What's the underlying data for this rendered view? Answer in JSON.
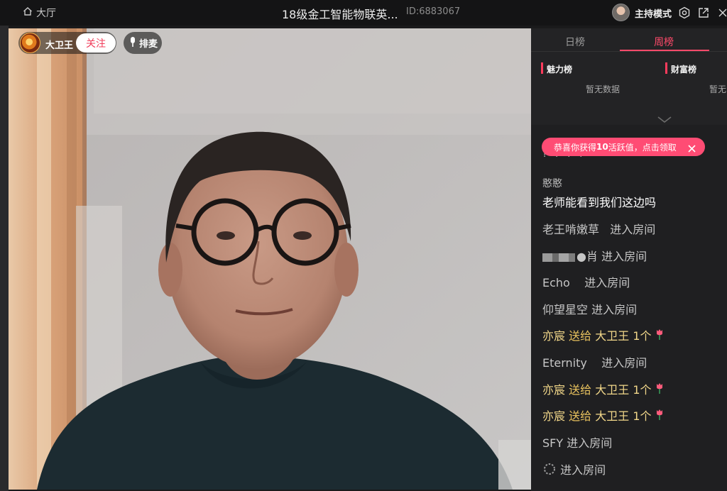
{
  "topbar": {
    "hall_label": "大厅",
    "room_title": "18级金工智能物联英...",
    "room_id": "ID:6883067",
    "host_mode_label": "主持模式",
    "icons": [
      "home-icon",
      "settings-gear-icon",
      "popout-icon",
      "close-icon"
    ]
  },
  "stage": {
    "anchor_name": "大卫王",
    "follow_label": "关注",
    "queue_label": "排麦"
  },
  "rank": {
    "tabs": [
      {
        "label": "日榜",
        "active": false
      },
      {
        "label": "周榜",
        "active": true
      }
    ],
    "categories": [
      {
        "label": "魅力榜",
        "empty": "暂无数据"
      },
      {
        "label": "财富榜",
        "empty": "暂无"
      }
    ]
  },
  "toast": {
    "prefix": "恭喜你获得",
    "amount": "10",
    "suffix": "活跃值，点击领取"
  },
  "chat": {
    "question_marks": "? ? ? ?",
    "message": {
      "user": "憨憨",
      "text": "老师能看到我们这边吗"
    },
    "entry_suffix": "进入房间",
    "gift_verb": "送给",
    "entries": [
      {
        "kind": "enter",
        "name": "老王啃嫩草"
      },
      {
        "kind": "enter",
        "name": "●肖"
      },
      {
        "kind": "enter",
        "name": "Echo"
      },
      {
        "kind": "enter",
        "name": "仰望星空"
      },
      {
        "kind": "gift",
        "name": "亦宸",
        "target": "大卫王",
        "count": "1个"
      },
      {
        "kind": "enter",
        "name": "Eternity"
      },
      {
        "kind": "gift",
        "name": "亦宸",
        "target": "大卫王",
        "count": "1个"
      },
      {
        "kind": "gift",
        "name": "亦宸",
        "target": "大卫王",
        "count": "1个"
      },
      {
        "kind": "enter",
        "name": "SFY"
      },
      {
        "kind": "enter",
        "name": ""
      }
    ]
  },
  "colors": {
    "accent": "#ff4a6a",
    "toast": "#ff4c74",
    "gift_name": "#f3d88a"
  }
}
